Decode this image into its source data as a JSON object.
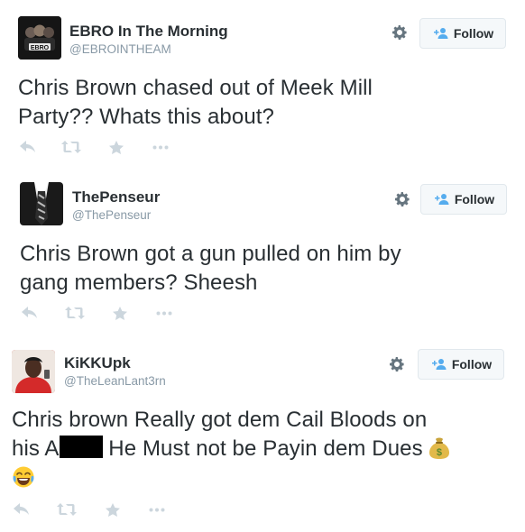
{
  "tweets": [
    {
      "name": "EBRO In The Morning",
      "handle": "@EBROINTHEAM",
      "follow_label": "Follow",
      "avatar_text": "EBRO",
      "text_lines": [
        "Chris Brown chased out of Meek Mill",
        "Party?? Whats this about?"
      ]
    },
    {
      "name": "ThePenseur",
      "handle": "@ThePenseur",
      "follow_label": "Follow",
      "text_lines": [
        "Chris Brown got a gun pulled on him by",
        "gang members? Sheesh"
      ]
    },
    {
      "name": "KiKKUpk",
      "handle": "@TheLeanLant3rn",
      "follow_label": "Follow",
      "text_line1": "Chris brown Really got dem Cail Bloods on",
      "text_line2_a": "his A",
      "text_line2_b": " He Must not be Payin dem Dues"
    }
  ],
  "icons": [
    "reply-icon",
    "retweet-icon",
    "favorite-icon",
    "more-icon",
    "gear-icon",
    "follow-person-icon",
    "money-bag-emoji",
    "crying-laughing-emoji"
  ],
  "colors": {
    "accent": "#55acee",
    "action_gray": "#ccd6dd",
    "handle_gray": "#8899a6",
    "text": "#292f33"
  }
}
